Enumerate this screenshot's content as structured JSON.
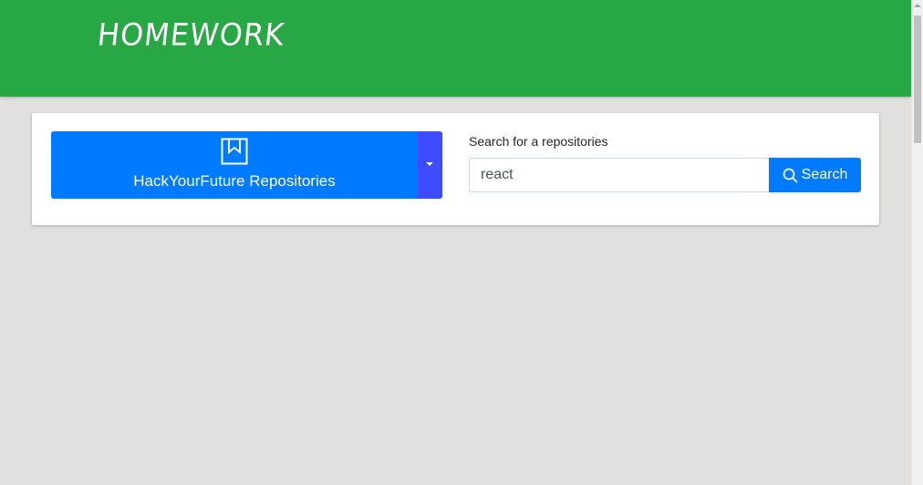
{
  "header": {
    "title": "HOMEWORK",
    "background_color": "#28a745"
  },
  "repo_selector": {
    "label": "HackYourFuture Repositories",
    "icon": "bookmark-book-icon",
    "dropdown_icon": "caret-down-icon",
    "color": "#007bff",
    "toggle_color": "#3f4bff"
  },
  "search": {
    "label": "Search for a repositories",
    "value": "react",
    "button_label": "Search",
    "button_icon": "search-icon",
    "button_color": "#007bff"
  }
}
